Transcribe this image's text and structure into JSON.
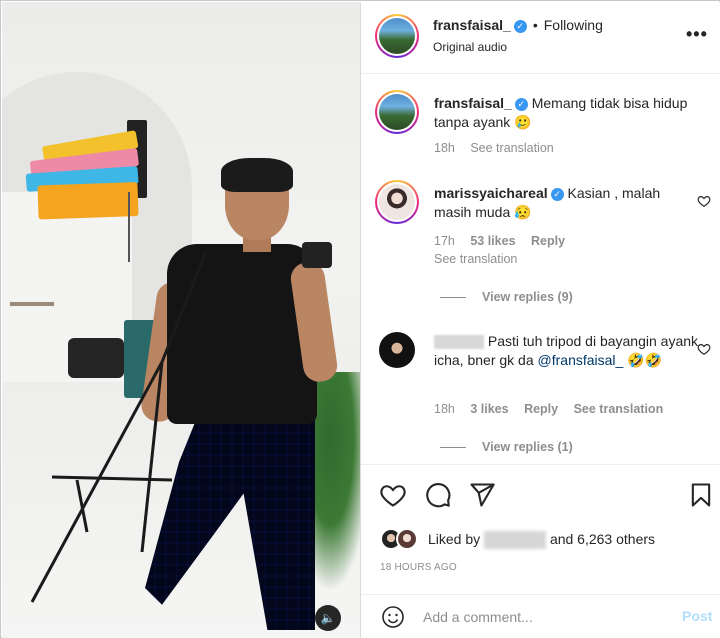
{
  "header": {
    "username": "fransfaisal_",
    "separator": "•",
    "follow_status": "Following",
    "audio": "Original audio",
    "more_icon": "more-horizontal-icon"
  },
  "comments": [
    {
      "username": "fransfaisal_",
      "text": "Memang tidak bisa hidup tanpa ayank 🥲",
      "time": "18h",
      "see_translation": "See translation"
    },
    {
      "username": "marissyaichareal",
      "text": "Kasian , malah masih muda 😥",
      "time": "17h",
      "likes": "53 likes",
      "reply": "Reply",
      "see_translation": "See translation",
      "view_replies": "View replies (9)"
    },
    {
      "username_blurred": "netyjalu",
      "text_part1": "Pasti tuh tripod di bayangin ayank icha, bner gk da",
      "mention": "@fransfaisal_",
      "emoji": "🤣🤣",
      "time": "18h",
      "likes": "3 likes",
      "reply": "Reply",
      "see_translation": "See translation",
      "view_replies": "View replies (1)"
    }
  ],
  "actions": {
    "like_icon": "heart-icon",
    "comment_icon": "comment-icon",
    "share_icon": "share-icon",
    "save_icon": "bookmark-icon"
  },
  "likes": {
    "prefix": "Liked by",
    "suffix": "and 6,263 others"
  },
  "timestamp": "18 HOURS AGO",
  "add_comment": {
    "placeholder": "Add a comment...",
    "post_label": "Post"
  },
  "media": {
    "mute_icon": "volume-icon"
  },
  "colors": {
    "verified": "#3897f0",
    "post_disabled": "#b2dffc",
    "mention": "#00376b"
  }
}
